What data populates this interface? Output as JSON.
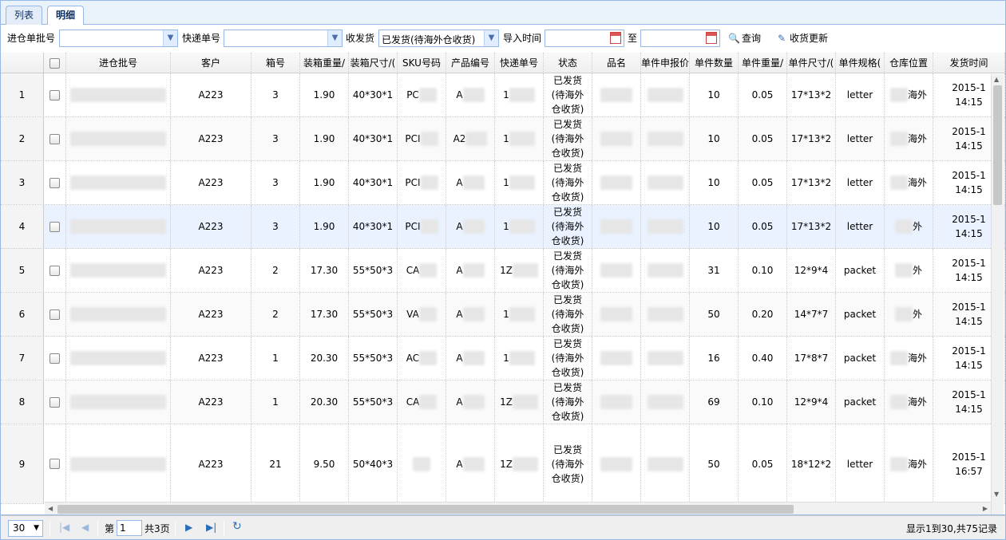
{
  "tabs": [
    {
      "label": "列表"
    },
    {
      "label": "明细"
    }
  ],
  "toolbar": {
    "batch_label": "进仓单批号",
    "batch_value": "",
    "express_label": "快递单号",
    "express_value": "",
    "status_label": "收发货",
    "status_value": "已发货(待海外仓收货)",
    "import_label": "导入时间",
    "date_from": "",
    "to_label": "至",
    "date_to": "",
    "query_label": "查询",
    "update_label": "收货更新"
  },
  "columns": [
    "进仓批号",
    "客户",
    "箱号",
    "装箱重量/",
    "装箱尺寸/(",
    "SKU号码",
    "产品编号",
    "快递单号",
    "状态",
    "品名",
    "单件申报价",
    "单件数量",
    "单件重量/",
    "单件尺寸/(",
    "单件规格(",
    "仓库位置",
    "发货时间"
  ],
  "rows": [
    {
      "num": "1",
      "customer": "A223",
      "box": "3",
      "weight": "1.90",
      "size": "40*30*1",
      "sku": "PC",
      "product": "A",
      "express": "1",
      "status": "已发货(待海外仓收货)",
      "qty": "10",
      "unit_weight": "0.05",
      "unit_size": "17*13*2",
      "spec": "letter",
      "location": "海外",
      "date": "2015-1",
      "time": "14:15"
    },
    {
      "num": "2",
      "customer": "A223",
      "box": "3",
      "weight": "1.90",
      "size": "40*30*1",
      "sku": "PCI",
      "product": "A2",
      "express": "1",
      "status": "已发货(待海外仓收货)",
      "qty": "10",
      "unit_weight": "0.05",
      "unit_size": "17*13*2",
      "spec": "letter",
      "location": "海外",
      "date": "2015-1",
      "time": "14:15"
    },
    {
      "num": "3",
      "customer": "A223",
      "box": "3",
      "weight": "1.90",
      "size": "40*30*1",
      "sku": "PCI",
      "product": "A",
      "express": "1",
      "status": "已发货(待海外仓收货)",
      "qty": "10",
      "unit_weight": "0.05",
      "unit_size": "17*13*2",
      "spec": "letter",
      "location": "海外",
      "date": "2015-1",
      "time": "14:15"
    },
    {
      "num": "4",
      "customer": "A223",
      "box": "3",
      "weight": "1.90",
      "size": "40*30*1",
      "sku": "PCI",
      "product": "A",
      "express": "1",
      "status": "已发货(待海外仓收货)",
      "qty": "10",
      "unit_weight": "0.05",
      "unit_size": "17*13*2",
      "spec": "letter",
      "location": "外",
      "date": "2015-1",
      "time": "14:15"
    },
    {
      "num": "5",
      "customer": "A223",
      "box": "2",
      "weight": "17.30",
      "size": "55*50*3",
      "sku": "CA",
      "product": "A",
      "express": "1Z",
      "status": "已发货(待海外仓收货)",
      "qty": "31",
      "unit_weight": "0.10",
      "unit_size": "12*9*4",
      "spec": "packet",
      "location": "外",
      "date": "2015-1",
      "time": "14:15"
    },
    {
      "num": "6",
      "customer": "A223",
      "box": "2",
      "weight": "17.30",
      "size": "55*50*3",
      "sku": "VA",
      "product": "A",
      "express": "1",
      "status": "已发货(待海外仓收货)",
      "qty": "50",
      "unit_weight": "0.20",
      "unit_size": "14*7*7",
      "spec": "packet",
      "location": "外",
      "date": "2015-1",
      "time": "14:15"
    },
    {
      "num": "7",
      "customer": "A223",
      "box": "1",
      "weight": "20.30",
      "size": "55*50*3",
      "sku": "AC",
      "product": "A",
      "express": "1",
      "status": "已发货(待海外仓收货)",
      "qty": "16",
      "unit_weight": "0.40",
      "unit_size": "17*8*7",
      "spec": "packet",
      "location": "海外",
      "date": "2015-1",
      "time": "14:15"
    },
    {
      "num": "8",
      "customer": "A223",
      "box": "1",
      "weight": "20.30",
      "size": "55*50*3",
      "sku": "CA",
      "product": "A",
      "express": "1Z",
      "status": "已发货(待海外仓收货)",
      "qty": "69",
      "unit_weight": "0.10",
      "unit_size": "12*9*4",
      "spec": "packet",
      "location": "海外",
      "date": "2015-1",
      "time": "14:15"
    },
    {
      "num": "9",
      "customer": "A223",
      "box": "21",
      "weight": "9.50",
      "size": "50*40*3",
      "sku": "",
      "product": "A",
      "express": "1Z",
      "status": "已发货(待海外仓收货)",
      "qty": "50",
      "unit_weight": "0.05",
      "unit_size": "18*12*2",
      "spec": "letter",
      "location": "海外",
      "date": "2015-1",
      "time": "16:57"
    }
  ],
  "pager": {
    "page_size": "30",
    "page_prefix": "第",
    "page_value": "1",
    "page_total": "共3页",
    "summary": "显示1到30,共75记录"
  },
  "colors": {
    "border": "#95b8e7",
    "highlight_row": "#eaf2ff",
    "header_bg": "#efefef"
  }
}
